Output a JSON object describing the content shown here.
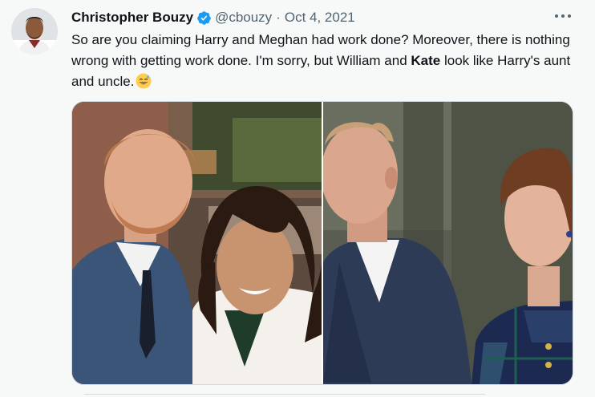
{
  "tweet": {
    "author_name": "Christopher Bouzy",
    "verified_icon": "verified-badge-icon",
    "handle": "@cbouzy",
    "separator": "·",
    "date": "Oct 4, 2021",
    "more_icon": "more-options-icon",
    "text_part1": "So are you claiming Harry and Meghan had work done? Moreover, there is nothing wrong with getting work done. I'm sorry, but William and ",
    "text_bold": "Kate",
    "text_part2": " look like Harry's aunt and uncle.",
    "emoji": "grinning-face-with-sweat-emoji"
  },
  "colors": {
    "background": "#f7f9f9",
    "verified_blue": "#1d9bf0",
    "secondary_text": "#536471",
    "primary_text": "#0f1419"
  }
}
